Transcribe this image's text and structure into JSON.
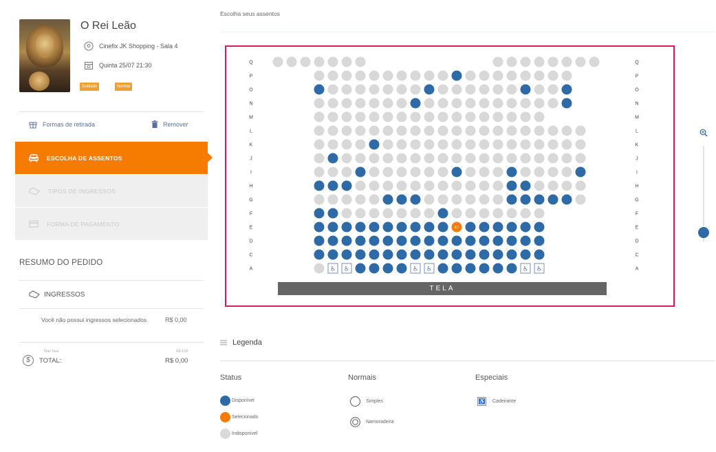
{
  "movie": {
    "title": "O Rei Leão",
    "cinema": "Cinefix JK Shopping - Sala 4",
    "datetime": "Quinta 25/07 21:30",
    "badges": [
      "Dublado",
      "Normal"
    ]
  },
  "actions": {
    "pickup": "Formas de retirada",
    "remove": "Remover"
  },
  "steps": [
    {
      "label": "ESCOLHA DE ASSENTOS",
      "icon": "seat-icon",
      "active": true
    },
    {
      "label": "TIPOS DE INGRESSOS",
      "icon": "ticket-icon",
      "active": false
    },
    {
      "label": "FORMA DE PAGAMENTO",
      "icon": "card-icon",
      "active": false
    }
  ],
  "summary": {
    "title": "RESUMO DO PEDIDO",
    "tickets_label": "INGRESSOS",
    "no_tickets": "Você não possui ingressos selecionados",
    "no_tickets_price": "R$ 0,00",
    "subtotal_label": "Total Taxa",
    "subtotal_value": "R$ 0,00",
    "total_label": "TOTAL:",
    "total_value": "R$ 0,00"
  },
  "seat_section": {
    "title": "Escolha seus assentos",
    "screen_label": "TELA"
  },
  "colors": {
    "available": "#2d6aa6",
    "selected": "#f57c00",
    "unavailable": "#d9d9d9",
    "accent": "#f57c00",
    "frame": "#d81b60"
  },
  "seat_map": {
    "row_labels": [
      "Q",
      "P",
      "O",
      "N",
      "M",
      "L",
      "K",
      "J",
      "I",
      "H",
      "G",
      "F",
      "E",
      "D",
      "C",
      "A"
    ],
    "selected_seat_label": "E7",
    "rows": [
      "UUUUUUU.........UUUUUUUU",
      "...UUUUUUUUUUAUUUUUUUU..",
      "...AUUUUUUUAUUUUUUAUUA..",
      "...UUUUUUUAUUUUUUUUUUA..",
      "...UUUUUUUUUUUUUUUUU....",
      "...UUUUUUUUUUUUUUUUUUUU.",
      "...UUUUAUUUUUUUUUUUUUUU.",
      "...UAUUUUUUUUUUUUUUUUUU.",
      "...UUUAUUUUUUAUUUAUUUUA.",
      "...AAAUUUUUUUUUUUAAUUUU.",
      "...UUUUUAAAUUUUUUAAAAAU.",
      "...AAUUUUUUUAUUUUUUU....",
      "...AAAAAAAAAASAAAAAA....",
      "...AAAAAAAAAAAAAAAAA....",
      "...AAAAAAAAAAAAAAAAA....",
      "...UWWAAAAWWAAAAAAWW...."
    ]
  },
  "legend": {
    "title": "Legenda",
    "status_title": "Status",
    "normal_title": "Normais",
    "special_title": "Especiais",
    "available": "Disponível",
    "selected": "Selecionado",
    "unavailable": "Indisponível",
    "simple": "Simples",
    "couple": "Namoradeira",
    "wheelchair": "Cadeirante"
  }
}
